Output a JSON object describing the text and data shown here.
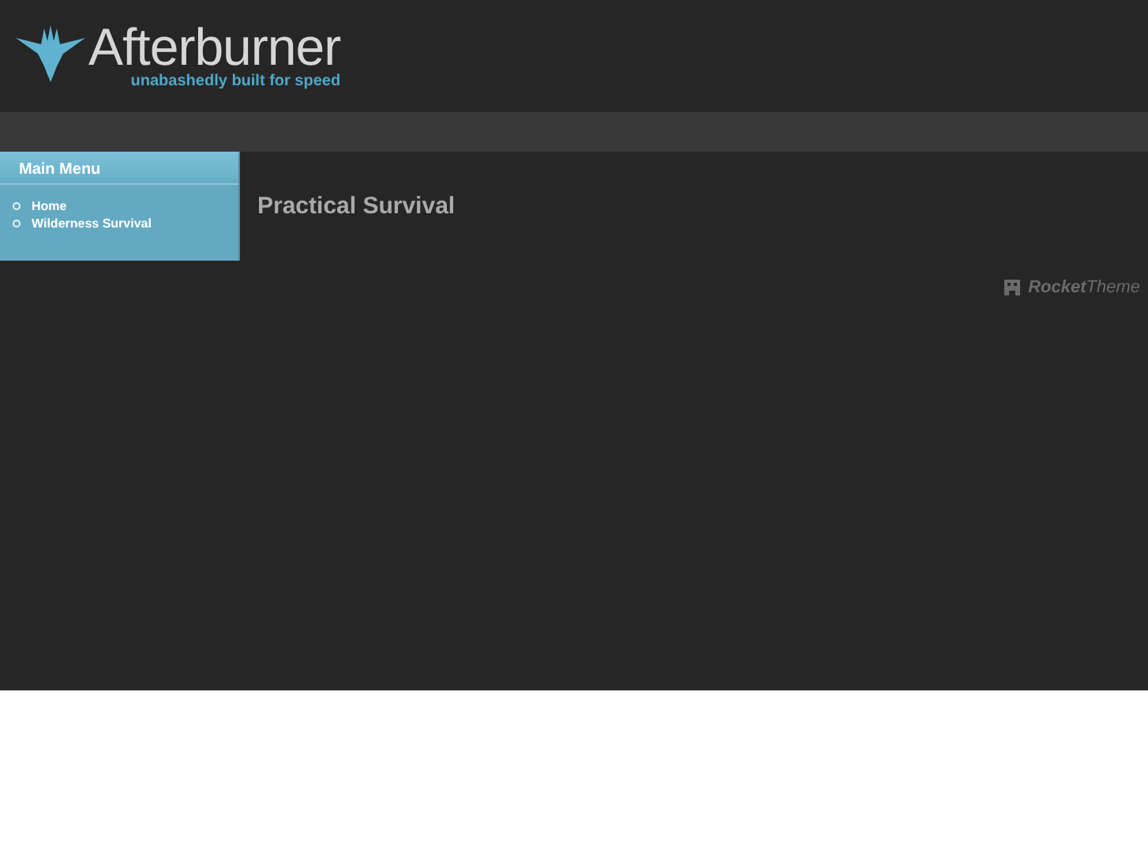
{
  "header": {
    "logo": "Afterburner",
    "tagline": "unabashedly built for speed"
  },
  "sidebar": {
    "title": "Main Menu",
    "items": [
      {
        "label": "Home"
      },
      {
        "label": "Wilderness Survival"
      }
    ]
  },
  "main": {
    "title": "Practical Survival"
  },
  "footer": {
    "credit": "**Rocket**Theme"
  }
}
